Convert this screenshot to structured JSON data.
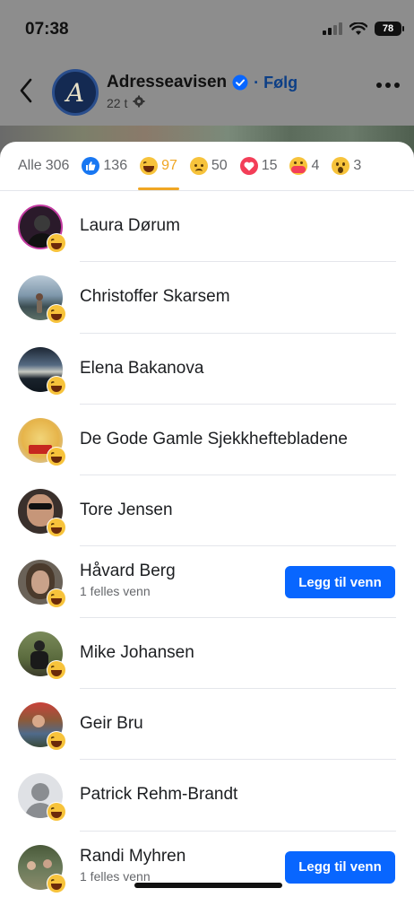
{
  "status_bar": {
    "time": "07:38",
    "battery": "78"
  },
  "post_header": {
    "page_name": "Adresseavisen",
    "follow_label": "· Følg",
    "post_age": "22 t",
    "avatar_letter": "A"
  },
  "tabs": [
    {
      "label": "Alle",
      "count": "306",
      "icon": ""
    },
    {
      "label": "",
      "count": "136",
      "icon": "like-icon"
    },
    {
      "label": "",
      "count": "97",
      "icon": "haha-icon"
    },
    {
      "label": "",
      "count": "50",
      "icon": "sad-icon"
    },
    {
      "label": "",
      "count": "15",
      "icon": "love-icon"
    },
    {
      "label": "",
      "count": "4",
      "icon": "care-icon"
    },
    {
      "label": "",
      "count": "3",
      "icon": "wow-icon"
    }
  ],
  "people": [
    {
      "name": "Laura Dørum",
      "mutual": "",
      "button": ""
    },
    {
      "name": "Christoffer Skarsem",
      "mutual": "",
      "button": ""
    },
    {
      "name": "Elena Bakanova",
      "mutual": "",
      "button": ""
    },
    {
      "name": "De Gode Gamle Sjekkheftebladene",
      "mutual": "",
      "button": ""
    },
    {
      "name": "Tore Jensen",
      "mutual": "",
      "button": ""
    },
    {
      "name": "Håvard Berg",
      "mutual": "1 felles venn",
      "button": "Legg til venn"
    },
    {
      "name": "Mike Johansen",
      "mutual": "",
      "button": ""
    },
    {
      "name": "Geir Bru",
      "mutual": "",
      "button": ""
    },
    {
      "name": "Patrick Rehm-Brandt",
      "mutual": "",
      "button": ""
    },
    {
      "name": "Randi Myhren",
      "mutual": "1 felles venn",
      "button": "Legg til venn"
    }
  ],
  "colors": {
    "accent": "#f0a623",
    "button": "#0866ff",
    "verified": "#0866ff"
  }
}
